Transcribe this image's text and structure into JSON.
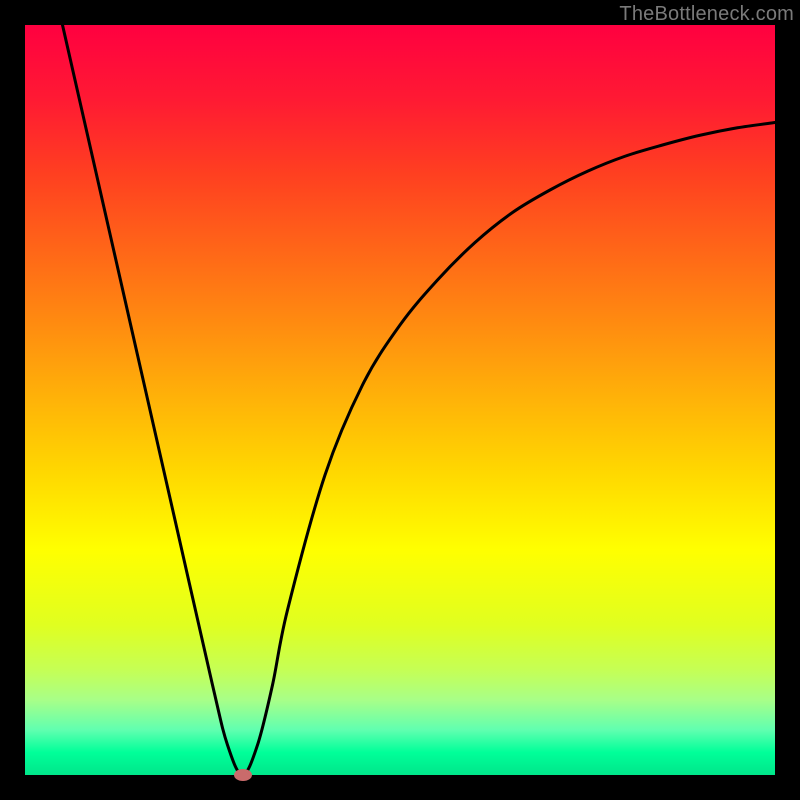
{
  "watermark": "TheBottleneck.com",
  "chart_data": {
    "type": "line",
    "title": "",
    "xlabel": "",
    "ylabel": "",
    "xlim": [
      0,
      100
    ],
    "ylim": [
      0,
      100
    ],
    "grid": false,
    "series": [
      {
        "name": "curve",
        "x": [
          5,
          10,
          15,
          20,
          25,
          27,
          29,
          31,
          33,
          35,
          40,
          45,
          50,
          55,
          60,
          65,
          70,
          75,
          80,
          85,
          90,
          95,
          100
        ],
        "values": [
          100,
          78,
          56,
          34,
          12,
          4,
          0,
          4,
          12,
          22,
          40,
          52,
          60,
          66,
          71,
          75,
          78,
          80.5,
          82.5,
          84,
          85.3,
          86.3,
          87
        ]
      }
    ],
    "marker": {
      "x": 29,
      "y": 0
    },
    "background_gradient": [
      "#ff0040",
      "#ff6618",
      "#ffff00",
      "#00e68a"
    ]
  }
}
